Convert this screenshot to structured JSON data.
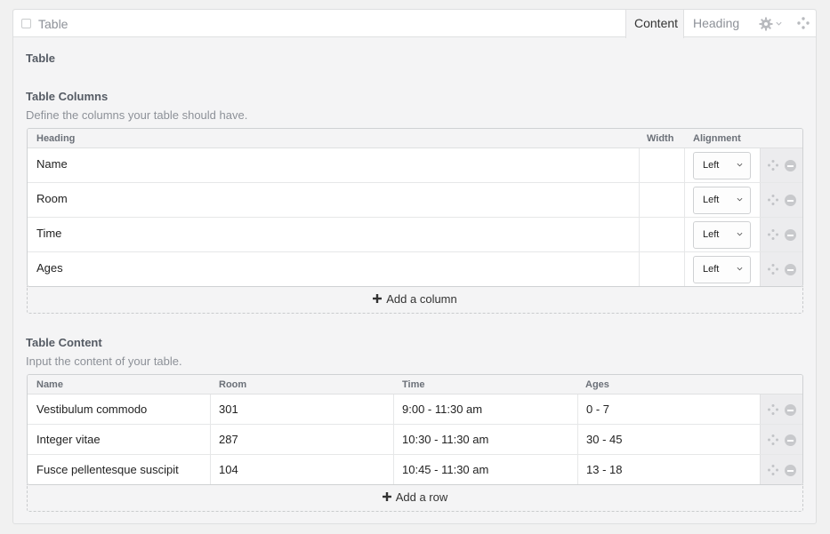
{
  "block": {
    "title": "Table",
    "tabs": [
      {
        "label": "Content",
        "active": true
      },
      {
        "label": "Heading",
        "active": false
      }
    ],
    "settings_icon": "gear-icon",
    "move_icon": "move-icon"
  },
  "section_title": "Table",
  "columns_section": {
    "title": "Table Columns",
    "description": "Define the columns your table should have.",
    "headers": {
      "heading": "Heading",
      "width": "Width",
      "alignment": "Alignment"
    },
    "rows": [
      {
        "heading": "Name",
        "width": "",
        "alignment": "Left"
      },
      {
        "heading": "Room",
        "width": "",
        "alignment": "Left"
      },
      {
        "heading": "Time",
        "width": "",
        "alignment": "Left"
      },
      {
        "heading": "Ages",
        "width": "",
        "alignment": "Left"
      }
    ],
    "add_label": "Add a column"
  },
  "content_section": {
    "title": "Table Content",
    "description": "Input the content of your table.",
    "headers": [
      "Name",
      "Room",
      "Time",
      "Ages"
    ],
    "rows": [
      [
        "Vestibulum commodo",
        "301",
        "9:00 - 11:30 am",
        "0 - 7"
      ],
      [
        "Integer vitae",
        "287",
        "10:30 - 11:30 am",
        "30 - 45"
      ],
      [
        "Fusce pellentesque suscipit",
        "104",
        "10:45 - 11:30 am",
        "13 - 18"
      ]
    ],
    "add_label": "Add a row"
  },
  "colors": {
    "panel_bg": "#f4f4f5",
    "border": "#cfd1d3",
    "muted_text": "#8d9198",
    "heading_text": "#555b64"
  }
}
